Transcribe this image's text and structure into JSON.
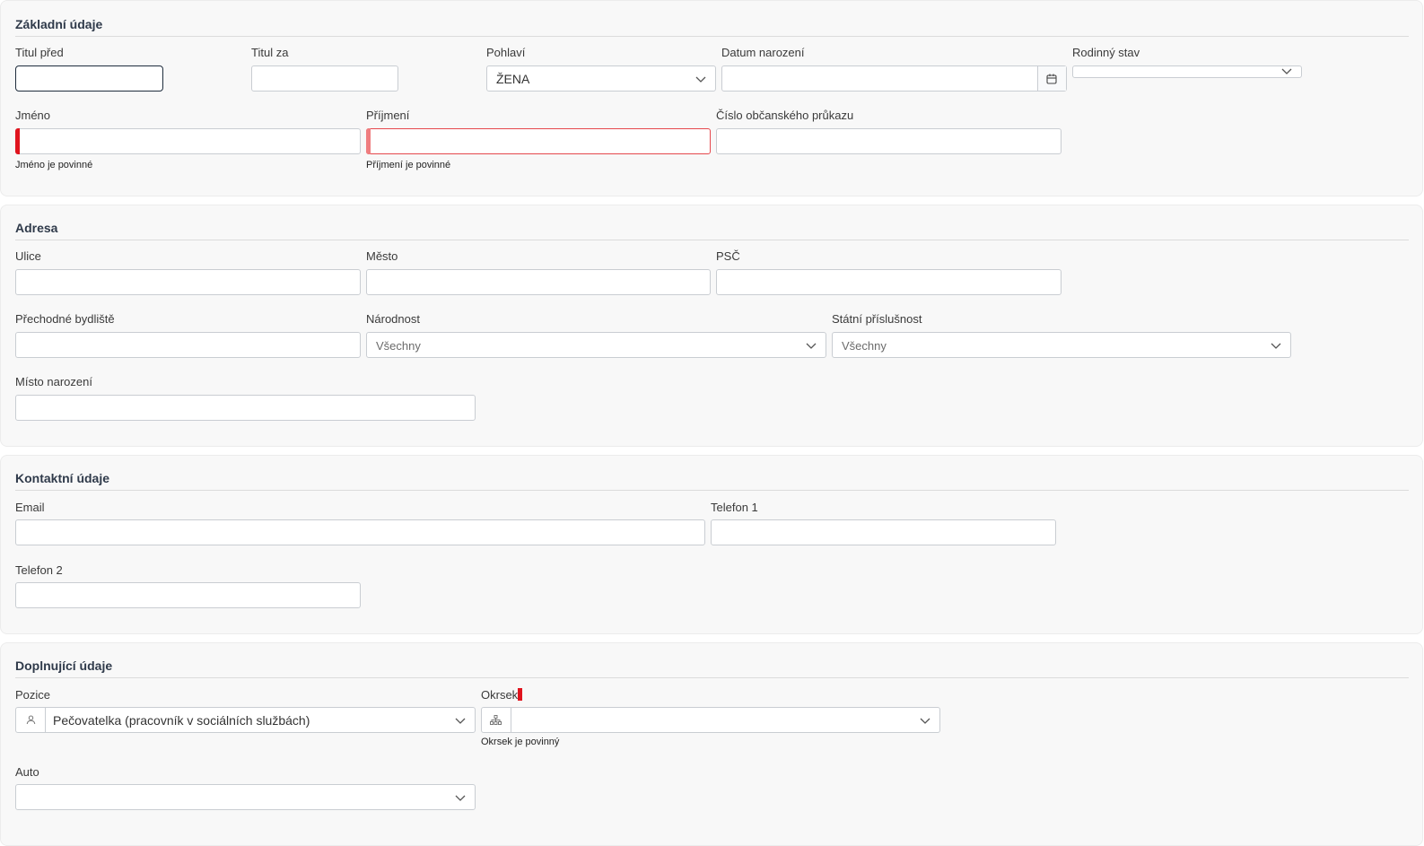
{
  "sections": {
    "basic": {
      "title": "Základní údaje",
      "titul_pred": {
        "label": "Titul před",
        "value": ""
      },
      "titul_za": {
        "label": "Titul za",
        "value": ""
      },
      "pohlavi": {
        "label": "Pohlaví",
        "value": "ŽENA"
      },
      "datum_narozeni": {
        "label": "Datum narození",
        "value": ""
      },
      "rodinny_stav": {
        "label": "Rodinný stav",
        "value": ""
      },
      "jmeno": {
        "label": "Jméno",
        "value": "",
        "error": "Jméno je povinné"
      },
      "prijmeni": {
        "label": "Příjmení",
        "value": "",
        "error": "Příjmení je povinné"
      },
      "cislo_op": {
        "label": "Číslo občanského průkazu",
        "value": ""
      }
    },
    "address": {
      "title": "Adresa",
      "ulice": {
        "label": "Ulice",
        "value": ""
      },
      "mesto": {
        "label": "Město",
        "value": ""
      },
      "psc": {
        "label": "PSČ",
        "value": ""
      },
      "prechodne": {
        "label": "Přechodné bydliště",
        "value": ""
      },
      "narodnost": {
        "label": "Národnost",
        "value": "Všechny"
      },
      "statni_prislusnost": {
        "label": "Státní příslušnost",
        "value": "Všechny"
      },
      "misto_narozeni": {
        "label": "Místo narození",
        "value": ""
      }
    },
    "contact": {
      "title": "Kontaktní údaje",
      "email": {
        "label": "Email",
        "value": ""
      },
      "telefon1": {
        "label": "Telefon 1",
        "value": ""
      },
      "telefon2": {
        "label": "Telefon 2",
        "value": ""
      }
    },
    "extra": {
      "title": "Doplnující údaje",
      "pozice": {
        "label": "Pozice",
        "value": "Pečovatelka (pracovník v sociálních službách)",
        "icon": "person-icon"
      },
      "okrsek": {
        "label": "Okrsek",
        "value": "",
        "error": "Okrsek je povinný",
        "icon": "hierarchy-icon"
      },
      "auto": {
        "label": "Auto",
        "value": ""
      }
    }
  },
  "colors": {
    "error": "#e0141e",
    "section_bg": "#f8f8f8",
    "border": "#c9cdd2",
    "title": "#2f3a4a"
  }
}
